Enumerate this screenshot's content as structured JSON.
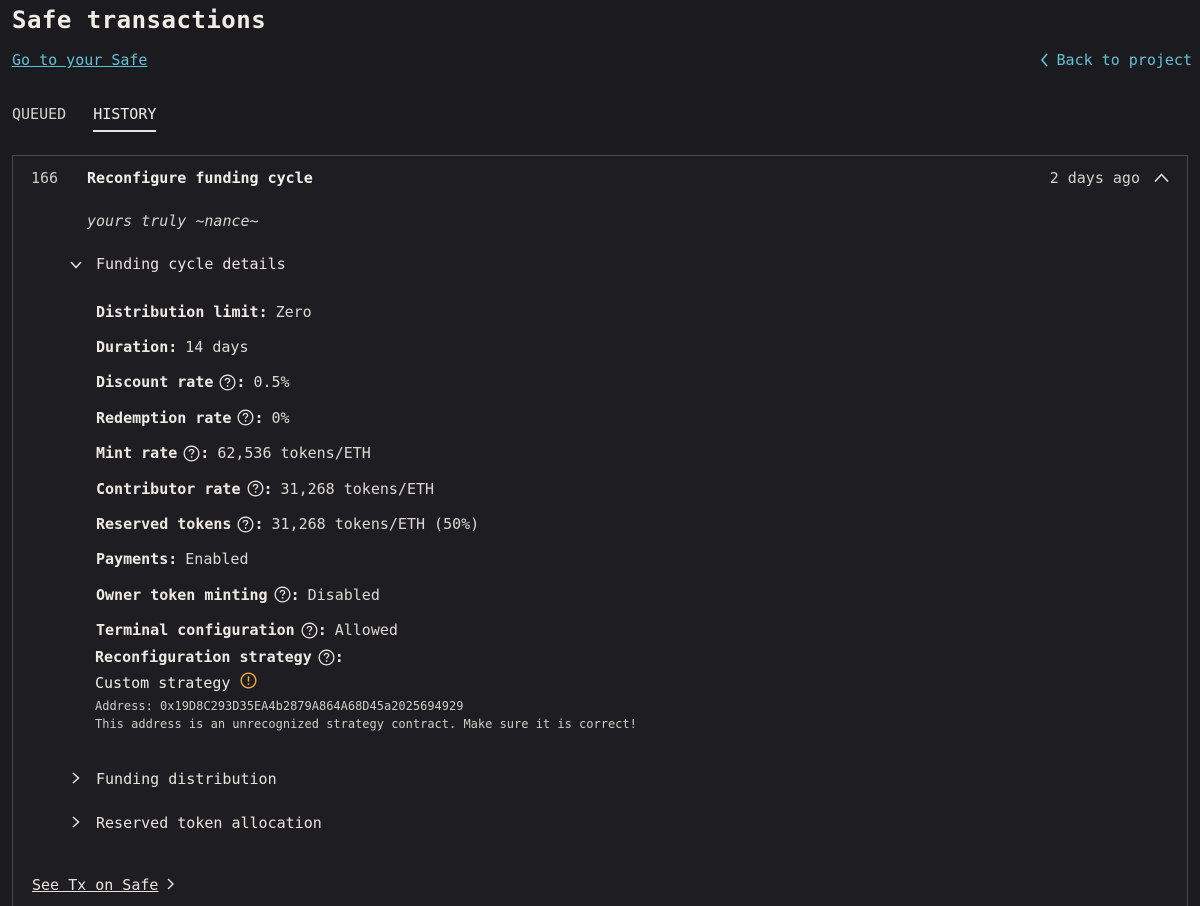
{
  "header": {
    "title": "Safe transactions",
    "safe_link": "Go to your Safe",
    "back_link": "Back to project"
  },
  "tabs": [
    {
      "label": "QUEUED",
      "active": false
    },
    {
      "label": "HISTORY",
      "active": true
    }
  ],
  "transaction": {
    "id": "166",
    "title": "Reconfigure funding cycle",
    "time": "2 days ago",
    "memo": "yours truly ~nance~",
    "sections": {
      "funding_cycle_details": "Funding cycle details",
      "funding_distribution": "Funding distribution",
      "reserved_token_allocation": "Reserved token allocation"
    },
    "details": [
      {
        "label": "Distribution limit",
        "value": "Zero",
        "help": false
      },
      {
        "label": "Duration",
        "value": "14 days",
        "help": false
      },
      {
        "label": "Discount rate",
        "value": "0.5%",
        "help": true
      },
      {
        "label": "Redemption rate",
        "value": "0%",
        "help": true
      },
      {
        "label": "Mint rate",
        "value": "62,536 tokens/ETH",
        "help": true
      },
      {
        "label": "Contributor rate",
        "value": "31,268 tokens/ETH",
        "help": true
      },
      {
        "label": "Reserved tokens",
        "value": "31,268 tokens/ETH (50%)",
        "help": true
      },
      {
        "label": "Payments",
        "value": "Enabled",
        "help": false
      },
      {
        "label": "Owner token minting",
        "value": "Disabled",
        "help": true
      },
      {
        "label": "Terminal configuration",
        "value": "Allowed",
        "help": true
      }
    ],
    "reconfiguration": {
      "label": "Reconfiguration strategy",
      "strategy": "Custom strategy",
      "address": "Address: 0x19D8C293D35EA4b2879A864A68D45a2025694929",
      "warning": "This address is an unrecognized strategy contract. Make sure it is correct!"
    },
    "see_tx": "See Tx on Safe"
  },
  "colors": {
    "background": "#1b1b1f",
    "link": "#5fc0d6",
    "warning": "#f0a93b",
    "border": "#48484e"
  },
  "icons": [
    "chevron-left-icon",
    "chevron-up-icon",
    "chevron-down-icon",
    "chevron-right-icon",
    "question-circle-icon",
    "warning-circle-icon"
  ]
}
